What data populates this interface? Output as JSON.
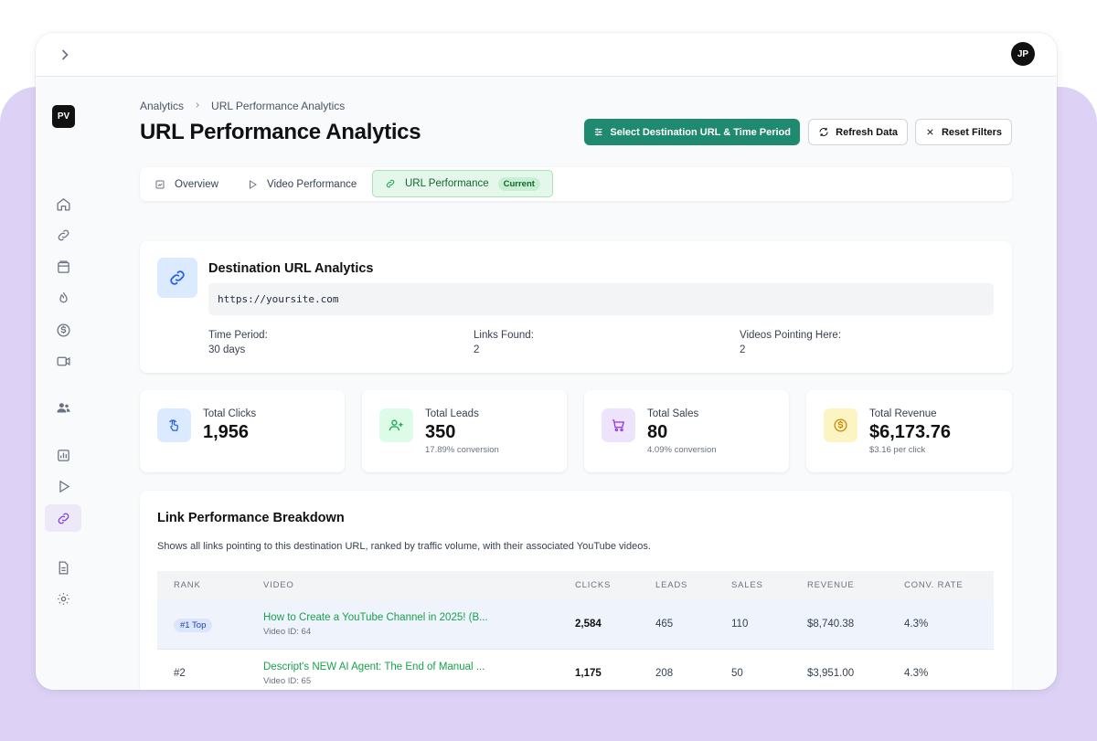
{
  "topbar": {
    "user_initials": "JP"
  },
  "sidebar": {
    "logo": "PV"
  },
  "breadcrumb": {
    "root": "Analytics",
    "current": "URL Performance Analytics"
  },
  "page": {
    "title": "URL Performance Analytics"
  },
  "actions": {
    "select_label": "Select Destination URL & Time Period",
    "refresh_label": "Refresh Data",
    "reset_label": "Reset Filters"
  },
  "tabs": [
    {
      "label": "Overview"
    },
    {
      "label": "Video Performance"
    },
    {
      "label": "URL Performance",
      "badge": "Current"
    }
  ],
  "destination": {
    "title": "Destination URL Analytics",
    "url": "https://yoursite.com",
    "time_period_label": "Time Period:",
    "time_period_value": "30 days",
    "links_found_label": "Links Found:",
    "links_found_value": "2",
    "videos_label": "Videos Pointing Here:",
    "videos_value": "2"
  },
  "stats": [
    {
      "label": "Total Clicks",
      "value": "1,956",
      "sub": "",
      "icon": "pointer-click-icon",
      "color": "#dbeafe"
    },
    {
      "label": "Total Leads",
      "value": "350",
      "sub": "17.89% conversion",
      "icon": "user-plus-icon",
      "color": "#dcfce7"
    },
    {
      "label": "Total Sales",
      "value": "80",
      "sub": "4.09% conversion",
      "icon": "cart-icon",
      "color": "#ede4fb"
    },
    {
      "label": "Total Revenue",
      "value": "$6,173.76",
      "sub": "$3.16 per click",
      "icon": "dollar-icon",
      "color": "#fdf4c4"
    }
  ],
  "breakdown": {
    "title": "Link Performance Breakdown",
    "description": "Shows all links pointing to this destination URL, ranked by traffic volume, with their associated YouTube videos.",
    "columns": [
      "RANK",
      "VIDEO",
      "CLICKS",
      "LEADS",
      "SALES",
      "REVENUE",
      "CONV. RATE"
    ],
    "rows": [
      {
        "rank": "#1 Top",
        "title": "How to Create a YouTube Channel in 2025! (B...",
        "video_id": "Video ID: 64",
        "clicks": "2,584",
        "leads": "465",
        "sales": "110",
        "revenue": "$8,740.38",
        "conv": "4.3%"
      },
      {
        "rank": "#2",
        "title": "Descript's NEW AI Agent: The End of Manual ...",
        "video_id": "Video ID: 65",
        "clicks": "1,175",
        "leads": "208",
        "sales": "50",
        "revenue": "$3,951.00",
        "conv": "4.3%"
      }
    ]
  }
}
